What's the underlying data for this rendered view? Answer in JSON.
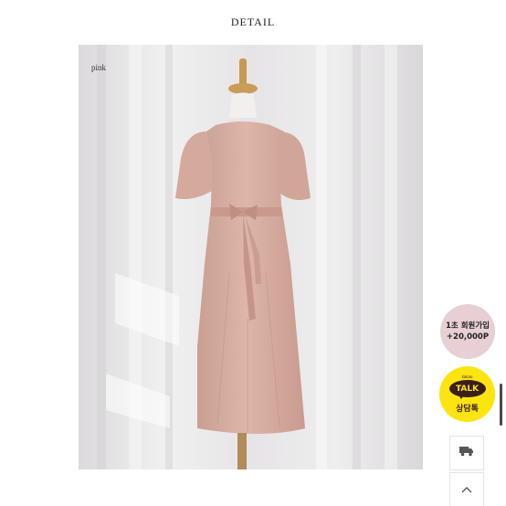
{
  "section": {
    "title": "DETAIL"
  },
  "product": {
    "color_label": "pink"
  },
  "promo": {
    "line1": "1초 회원가입",
    "line2": "+20,000P",
    "color": "#e8cfd3"
  },
  "kakao": {
    "badge": "TALK",
    "label": "상담톡",
    "small": "kakao",
    "color": "#fce410"
  },
  "side_buttons": [
    {
      "icon": "truck-icon"
    },
    {
      "icon": "chevron-up-icon"
    }
  ]
}
